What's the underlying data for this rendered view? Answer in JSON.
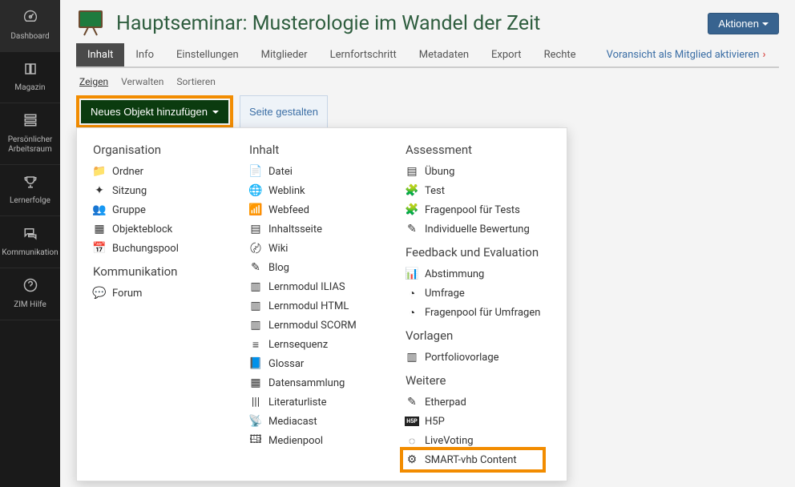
{
  "sidebar": {
    "items": [
      {
        "icon": "tachometer-icon",
        "glyph": "⌂",
        "label": "Dashboard"
      },
      {
        "icon": "book-icon",
        "glyph": "▤",
        "label": "Magazin"
      },
      {
        "icon": "user-icon",
        "glyph": "☰",
        "label": "Persönlicher Arbeitsraum"
      },
      {
        "icon": "trophy-icon",
        "glyph": "🏆",
        "label": "Lernerfolge"
      },
      {
        "icon": "comments-icon",
        "glyph": "💬",
        "label": "Kommunikation"
      },
      {
        "icon": "question-icon",
        "glyph": "？",
        "label": "ZIM Hilfe"
      }
    ]
  },
  "header": {
    "title": "Hauptseminar: Musterologie im Wandel der Zeit",
    "actions_label": "Aktionen"
  },
  "tabs": {
    "items": [
      "Inhalt",
      "Info",
      "Einstellungen",
      "Mitglieder",
      "Lernfortschritt",
      "Metadaten",
      "Export",
      "Rechte"
    ],
    "preview": "Voransicht als Mitglied aktivieren"
  },
  "subtabs": {
    "items": [
      "Zeigen",
      "Verwalten",
      "Sortieren"
    ]
  },
  "buttons": {
    "add_object": "Neues Objekt hinzufügen",
    "design_page": "Seite gestalten"
  },
  "dropdown": {
    "col1": {
      "groups": [
        {
          "heading": "Organisation",
          "items": [
            {
              "icon": "folder-icon",
              "glyph": "📁",
              "label": "Ordner"
            },
            {
              "icon": "session-icon",
              "glyph": "✦",
              "label": "Sitzung"
            },
            {
              "icon": "group-icon",
              "glyph": "👥",
              "label": "Gruppe"
            },
            {
              "icon": "itemgroup-icon",
              "glyph": "▦",
              "label": "Objekteblock"
            },
            {
              "icon": "calendar-icon",
              "glyph": "📅",
              "label": "Buchungspool"
            }
          ]
        },
        {
          "heading": "Kommunikation",
          "items": [
            {
              "icon": "forum-icon",
              "glyph": "💬",
              "label": "Forum"
            }
          ]
        }
      ]
    },
    "col2": {
      "groups": [
        {
          "heading": "Inhalt",
          "items": [
            {
              "icon": "file-icon",
              "glyph": "📄",
              "label": "Datei"
            },
            {
              "icon": "link-icon",
              "glyph": "🌐",
              "label": "Weblink"
            },
            {
              "icon": "feed-icon",
              "glyph": "📶",
              "label": "Webfeed"
            },
            {
              "icon": "page-icon",
              "glyph": "▤",
              "label": "Inhaltsseite"
            },
            {
              "icon": "wiki-icon",
              "glyph": "〄",
              "label": "Wiki"
            },
            {
              "icon": "blog-icon",
              "glyph": "✎",
              "label": "Blog"
            },
            {
              "icon": "lm-ilias-icon",
              "glyph": "▥",
              "label": "Lernmodul ILIAS"
            },
            {
              "icon": "lm-html-icon",
              "glyph": "▥",
              "label": "Lernmodul HTML"
            },
            {
              "icon": "lm-scorm-icon",
              "glyph": "▥",
              "label": "Lernmodul SCORM"
            },
            {
              "icon": "sequence-icon",
              "glyph": "≡",
              "label": "Lernsequenz"
            },
            {
              "icon": "glossary-icon",
              "glyph": "📘",
              "label": "Glossar"
            },
            {
              "icon": "datacoll-icon",
              "glyph": "▦",
              "label": "Datensammlung"
            },
            {
              "icon": "biblio-icon",
              "glyph": "|||",
              "label": "Literaturliste"
            },
            {
              "icon": "mediacast-icon",
              "glyph": "📡",
              "label": "Mediacast"
            },
            {
              "icon": "mediapool-icon",
              "glyph": "🖽",
              "label": "Medienpool"
            }
          ]
        }
      ]
    },
    "col3": {
      "groups": [
        {
          "heading": "Assessment",
          "items": [
            {
              "icon": "exercise-icon",
              "glyph": "▤",
              "label": "Übung"
            },
            {
              "icon": "test-icon",
              "glyph": "🧩",
              "label": "Test"
            },
            {
              "icon": "qpool-icon",
              "glyph": "🧩",
              "label": "Fragenpool für Tests"
            },
            {
              "icon": "iassess-icon",
              "glyph": "✎",
              "label": "Individuelle Bewertung"
            }
          ]
        },
        {
          "heading": "Feedback und Evaluation",
          "items": [
            {
              "icon": "poll-icon",
              "glyph": "📊",
              "label": "Abstimmung"
            },
            {
              "icon": "survey-icon",
              "glyph": "◔",
              "label": "Umfrage"
            },
            {
              "icon": "spq-icon",
              "glyph": "◔",
              "label": "Fragenpool für Umfragen"
            }
          ]
        },
        {
          "heading": "Vorlagen",
          "items": [
            {
              "icon": "portfolio-icon",
              "glyph": "▥",
              "label": "Portfoliovorlage"
            }
          ]
        },
        {
          "heading": "Weitere",
          "items": [
            {
              "icon": "etherpad-icon",
              "glyph": "✎",
              "label": "Etherpad"
            },
            {
              "icon": "h5p-icon",
              "glyph": "H5P",
              "label": "H5P"
            },
            {
              "icon": "livevoting-icon",
              "glyph": "◌",
              "label": "LiveVoting"
            },
            {
              "icon": "smartvhb-icon",
              "glyph": "⚙",
              "label": "SMART-vhb Content",
              "highlight": true
            }
          ]
        }
      ]
    }
  }
}
